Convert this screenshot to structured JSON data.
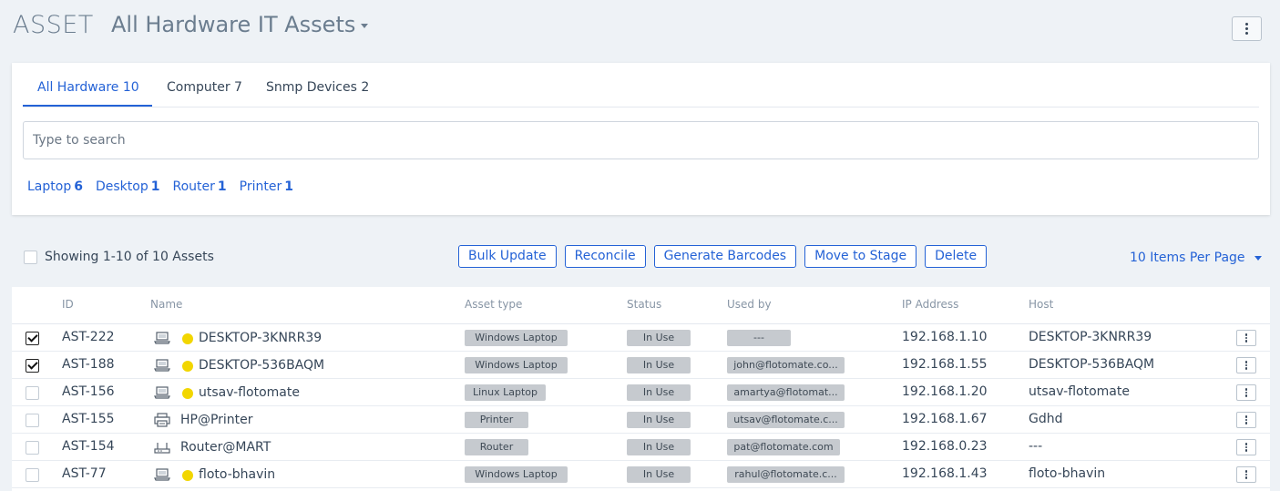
{
  "header": {
    "module": "ASSET",
    "view": "All Hardware IT Assets"
  },
  "tabs": [
    {
      "label": "All Hardware 10",
      "active": true
    },
    {
      "label": "Computer 7",
      "active": false
    },
    {
      "label": "Snmp Devices 2",
      "active": false
    }
  ],
  "search": {
    "placeholder": "Type to search",
    "value": ""
  },
  "quick_filters": [
    {
      "label": "Laptop",
      "count": "6"
    },
    {
      "label": "Desktop",
      "count": "1"
    },
    {
      "label": "Router",
      "count": "1"
    },
    {
      "label": "Printer",
      "count": "1"
    }
  ],
  "toolbar": {
    "showing": "Showing 1-10 of 10 Assets",
    "actions": [
      "Bulk Update",
      "Reconcile",
      "Generate Barcodes",
      "Move to Stage",
      "Delete"
    ],
    "per_page": "10 Items Per Page"
  },
  "columns": [
    "ID",
    "Name",
    "Asset type",
    "Status",
    "Used by",
    "IP Address",
    "Host"
  ],
  "rows": [
    {
      "checked": true,
      "id": "AST-222",
      "icon": "laptop-icon",
      "online": true,
      "name": "DESKTOP-3KNRR39",
      "type": "Windows Laptop",
      "status": "In Use",
      "used_by": "---",
      "ip": "192.168.1.10",
      "host": "DESKTOP-3KNRR39"
    },
    {
      "checked": true,
      "id": "AST-188",
      "icon": "laptop-icon",
      "online": true,
      "name": "DESKTOP-536BAQM",
      "type": "Windows Laptop",
      "status": "In Use",
      "used_by": "john@flotomate.co...",
      "ip": "192.168.1.55",
      "host": "DESKTOP-536BAQM"
    },
    {
      "checked": false,
      "id": "AST-156",
      "icon": "laptop-icon",
      "online": true,
      "name": "utsav-flotomate",
      "type": "Linux Laptop",
      "status": "In Use",
      "used_by": "amartya@flotomat...",
      "ip": "192.168.1.20",
      "host": "utsav-flotomate"
    },
    {
      "checked": false,
      "id": "AST-155",
      "icon": "printer-icon",
      "online": false,
      "name": "HP@Printer",
      "type": "Printer",
      "status": "In Use",
      "used_by": "utsav@flotomate.c...",
      "ip": "192.168.1.67",
      "host": "Gdhd"
    },
    {
      "checked": false,
      "id": "AST-154",
      "icon": "router-icon",
      "online": false,
      "name": "Router@MART",
      "type": "Router",
      "status": "In Use",
      "used_by": "pat@flotomate.com",
      "ip": "192.168.0.23",
      "host": "---"
    },
    {
      "checked": false,
      "id": "AST-77",
      "icon": "laptop-icon",
      "online": true,
      "name": "floto-bhavin",
      "type": "Windows Laptop",
      "status": "In Use",
      "used_by": "rahul@flotomate.c...",
      "ip": "192.168.1.43",
      "host": "floto-bhavin"
    }
  ],
  "colors": {
    "accent": "#2462d6",
    "online_dot": "#f2d600",
    "pill_bg": "#c6cacf"
  }
}
